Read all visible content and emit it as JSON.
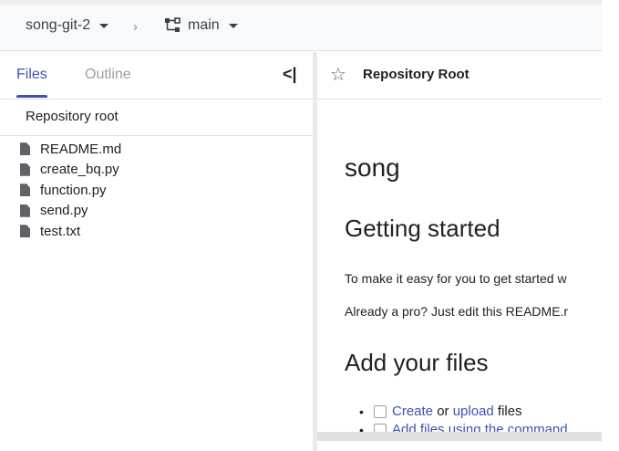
{
  "breadcrumb": {
    "repo": "song-git-2",
    "separator": "›",
    "branch": "main"
  },
  "sidebar": {
    "tabs": [
      {
        "label": "Files",
        "active": true
      },
      {
        "label": "Outline",
        "active": false
      }
    ],
    "collapse_glyph": "<|",
    "root_label": "Repository root",
    "files": [
      {
        "name": "README.md"
      },
      {
        "name": "create_bq.py"
      },
      {
        "name": "function.py"
      },
      {
        "name": "send.py"
      },
      {
        "name": "test.txt"
      }
    ]
  },
  "main": {
    "star_glyph": "☆",
    "header_title": "Repository Root",
    "readme": {
      "title": "song",
      "section1": "Getting started",
      "para1": "To make it easy for you to get started w",
      "para2": "Already a pro? Just edit this README.r",
      "section2": "Add your files",
      "task1": {
        "link1": "Create",
        "mid": " or ",
        "link2": "upload",
        "tail": " files"
      },
      "task2": {
        "link": "Add files using the command"
      }
    }
  },
  "colors": {
    "accent": "#3f51b5",
    "topbar_bg": "#f8f9fa",
    "divider": "#e8eaed"
  }
}
